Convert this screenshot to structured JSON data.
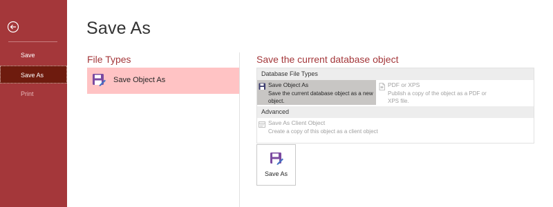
{
  "sidebar": {
    "back_icon": "back-arrow-icon",
    "items": [
      {
        "label": "Save",
        "state": "normal"
      },
      {
        "label": "Save As",
        "state": "selected"
      },
      {
        "label": "Print",
        "state": "disabled"
      }
    ]
  },
  "page": {
    "title": "Save As"
  },
  "file_types": {
    "heading": "File Types",
    "items": [
      {
        "label": "Save Object As",
        "icon": "save-object-icon",
        "selected": true
      }
    ]
  },
  "save_current": {
    "heading": "Save the current database object",
    "groups": [
      {
        "header": "Database File Types",
        "options": [
          {
            "title": "Save Object As",
            "description": "Save the current database object as a new object.",
            "icon": "save-object-small-icon",
            "selected": true
          },
          {
            "title": "PDF or XPS",
            "description": "Publish a copy of the object as a PDF or XPS file.",
            "icon": "pdf-document-icon",
            "enabled": false
          }
        ]
      },
      {
        "header": "Advanced",
        "options": [
          {
            "title": "Save As Client Object",
            "description": "Create a copy of this object as a client object",
            "icon": "client-object-icon",
            "enabled": false
          }
        ]
      }
    ],
    "save_as_button": {
      "label": "Save As",
      "icon": "save-as-icon"
    }
  },
  "colors": {
    "accent": "#a4373a",
    "sidebar_selected": "#6e1b0e",
    "selection_pink": "#ffc3c4",
    "option_selected": "#c8c6c4",
    "icon_purple": "#7b4aa0"
  }
}
